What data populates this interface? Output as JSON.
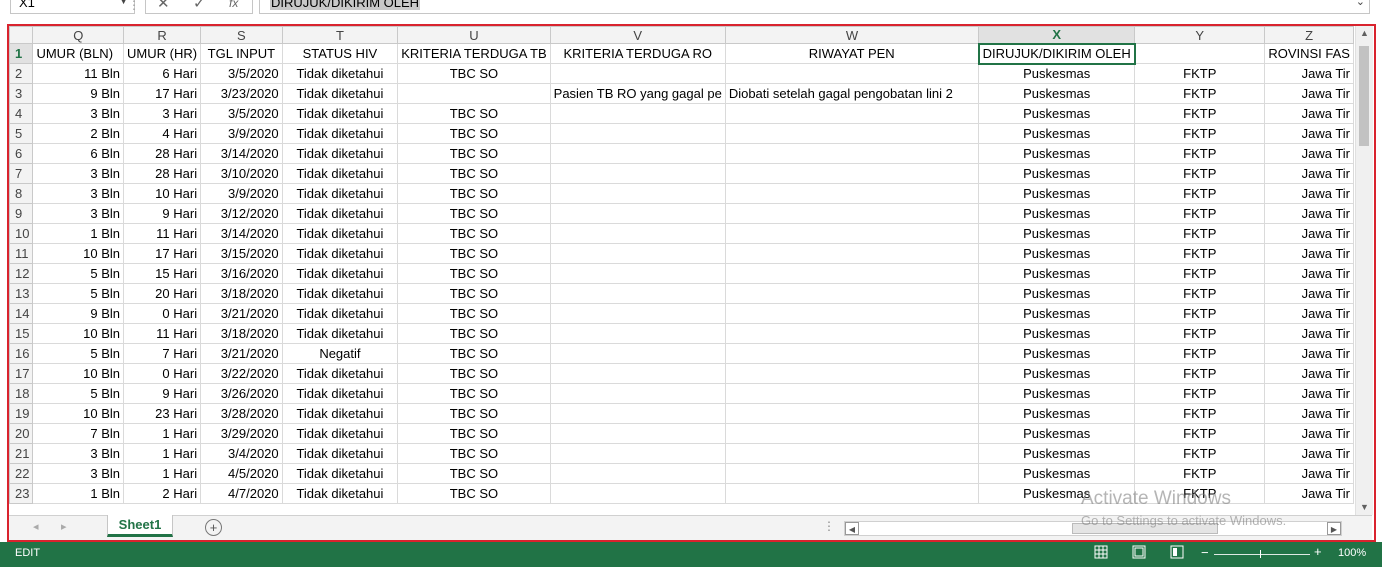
{
  "formula_bar": {
    "name_box": "X1",
    "cancel_icon": "✕",
    "enter_icon": "✓",
    "fx_label": "fx",
    "formula_value": "DIRUJUK/DIKIRIM OLEH"
  },
  "sheet": {
    "selected_cell": "X1",
    "columns": [
      {
        "letter": "Q",
        "align": "r",
        "active": false
      },
      {
        "letter": "R",
        "align": "r",
        "active": false
      },
      {
        "letter": "S",
        "align": "r",
        "active": false
      },
      {
        "letter": "T",
        "align": "c",
        "active": false
      },
      {
        "letter": "U",
        "align": "c",
        "active": false
      },
      {
        "letter": "V",
        "align": "l",
        "active": false
      },
      {
        "letter": "W",
        "align": "l",
        "active": false
      },
      {
        "letter": "X",
        "align": "c",
        "active": true
      },
      {
        "letter": "Y",
        "align": "c",
        "active": false
      },
      {
        "letter": "Z",
        "align": "r",
        "active": false
      }
    ],
    "rows": [
      {
        "n": "1",
        "cells": [
          "UMUR (BLN)",
          "UMUR (HR)",
          "TGL INPUT",
          "STATUS HIV",
          "KRITERIA TERDUGA TB",
          "KRITERIA TERDUGA RO",
          "RIWAYAT PEN",
          "DIRUJUK/DIKIRIM OLEH",
          "",
          "ROVINSI FAS"
        ]
      },
      {
        "n": "2",
        "cells": [
          "11 Bln",
          "6 Hari",
          "3/5/2020",
          "Tidak diketahui",
          "TBC SO",
          "",
          "",
          "Puskesmas",
          "FKTP",
          "Jawa Tir"
        ]
      },
      {
        "n": "3",
        "cells": [
          "9 Bln",
          "17 Hari",
          "3/23/2020",
          "Tidak diketahui",
          "",
          "Pasien TB RO yang gagal pe",
          "Diobati setelah gagal pengobatan lini 2",
          "Puskesmas",
          "FKTP",
          "Jawa Tir"
        ]
      },
      {
        "n": "4",
        "cells": [
          "3 Bln",
          "3 Hari",
          "3/5/2020",
          "Tidak diketahui",
          "TBC SO",
          "",
          "",
          "Puskesmas",
          "FKTP",
          "Jawa Tir"
        ]
      },
      {
        "n": "5",
        "cells": [
          "2 Bln",
          "4 Hari",
          "3/9/2020",
          "Tidak diketahui",
          "TBC SO",
          "",
          "",
          "Puskesmas",
          "FKTP",
          "Jawa Tir"
        ]
      },
      {
        "n": "6",
        "cells": [
          "6 Bln",
          "28 Hari",
          "3/14/2020",
          "Tidak diketahui",
          "TBC SO",
          "",
          "",
          "Puskesmas",
          "FKTP",
          "Jawa Tir"
        ]
      },
      {
        "n": "7",
        "cells": [
          "3 Bln",
          "28 Hari",
          "3/10/2020",
          "Tidak diketahui",
          "TBC SO",
          "",
          "",
          "Puskesmas",
          "FKTP",
          "Jawa Tir"
        ]
      },
      {
        "n": "8",
        "cells": [
          "3 Bln",
          "10 Hari",
          "3/9/2020",
          "Tidak diketahui",
          "TBC SO",
          "",
          "",
          "Puskesmas",
          "FKTP",
          "Jawa Tir"
        ]
      },
      {
        "n": "9",
        "cells": [
          "3 Bln",
          "9 Hari",
          "3/12/2020",
          "Tidak diketahui",
          "TBC SO",
          "",
          "",
          "Puskesmas",
          "FKTP",
          "Jawa Tir"
        ]
      },
      {
        "n": "10",
        "cells": [
          "1 Bln",
          "11 Hari",
          "3/14/2020",
          "Tidak diketahui",
          "TBC SO",
          "",
          "",
          "Puskesmas",
          "FKTP",
          "Jawa Tir"
        ]
      },
      {
        "n": "11",
        "cells": [
          "10 Bln",
          "17 Hari",
          "3/15/2020",
          "Tidak diketahui",
          "TBC SO",
          "",
          "",
          "Puskesmas",
          "FKTP",
          "Jawa Tir"
        ]
      },
      {
        "n": "12",
        "cells": [
          "5 Bln",
          "15 Hari",
          "3/16/2020",
          "Tidak diketahui",
          "TBC SO",
          "",
          "",
          "Puskesmas",
          "FKTP",
          "Jawa Tir"
        ]
      },
      {
        "n": "13",
        "cells": [
          "5 Bln",
          "20 Hari",
          "3/18/2020",
          "Tidak diketahui",
          "TBC SO",
          "",
          "",
          "Puskesmas",
          "FKTP",
          "Jawa Tir"
        ]
      },
      {
        "n": "14",
        "cells": [
          "9 Bln",
          "0 Hari",
          "3/21/2020",
          "Tidak diketahui",
          "TBC SO",
          "",
          "",
          "Puskesmas",
          "FKTP",
          "Jawa Tir"
        ]
      },
      {
        "n": "15",
        "cells": [
          "10 Bln",
          "11 Hari",
          "3/18/2020",
          "Tidak diketahui",
          "TBC SO",
          "",
          "",
          "Puskesmas",
          "FKTP",
          "Jawa Tir"
        ]
      },
      {
        "n": "16",
        "cells": [
          "5 Bln",
          "7 Hari",
          "3/21/2020",
          "Negatif",
          "TBC SO",
          "",
          "",
          "Puskesmas",
          "FKTP",
          "Jawa Tir"
        ]
      },
      {
        "n": "17",
        "cells": [
          "10 Bln",
          "0 Hari",
          "3/22/2020",
          "Tidak diketahui",
          "TBC SO",
          "",
          "",
          "Puskesmas",
          "FKTP",
          "Jawa Tir"
        ]
      },
      {
        "n": "18",
        "cells": [
          "5 Bln",
          "9 Hari",
          "3/26/2020",
          "Tidak diketahui",
          "TBC SO",
          "",
          "",
          "Puskesmas",
          "FKTP",
          "Jawa Tir"
        ]
      },
      {
        "n": "19",
        "cells": [
          "10 Bln",
          "23 Hari",
          "3/28/2020",
          "Tidak diketahui",
          "TBC SO",
          "",
          "",
          "Puskesmas",
          "FKTP",
          "Jawa Tir"
        ]
      },
      {
        "n": "20",
        "cells": [
          "7 Bln",
          "1 Hari",
          "3/29/2020",
          "Tidak diketahui",
          "TBC SO",
          "",
          "",
          "Puskesmas",
          "FKTP",
          "Jawa Tir"
        ]
      },
      {
        "n": "21",
        "cells": [
          "3 Bln",
          "1 Hari",
          "3/4/2020",
          "Tidak diketahui",
          "TBC SO",
          "",
          "",
          "Puskesmas",
          "FKTP",
          "Jawa Tir"
        ]
      },
      {
        "n": "22",
        "cells": [
          "3 Bln",
          "1 Hari",
          "4/5/2020",
          "Tidak diketahui",
          "TBC SO",
          "",
          "",
          "Puskesmas",
          "FKTP",
          "Jawa Tir"
        ]
      },
      {
        "n": "23",
        "cells": [
          "1 Bln",
          "2 Hari",
          "4/7/2020",
          "Tidak diketahui",
          "TBC SO",
          "",
          "",
          "Puskesmas",
          "FKTP",
          "Jawa Tir"
        ]
      }
    ]
  },
  "tabs": {
    "sheets": [
      "Sheet1"
    ],
    "active": "Sheet1",
    "add_icon": "⊕"
  },
  "watermark": {
    "title": "Activate Windows",
    "subtitle": "Go to Settings to activate Windows."
  },
  "status_bar": {
    "mode": "EDIT",
    "zoom_minus": "−",
    "zoom_plus": "+",
    "zoom": "100%"
  },
  "colors": {
    "excel_green": "#217346",
    "highlight_frame": "#d9232e"
  }
}
